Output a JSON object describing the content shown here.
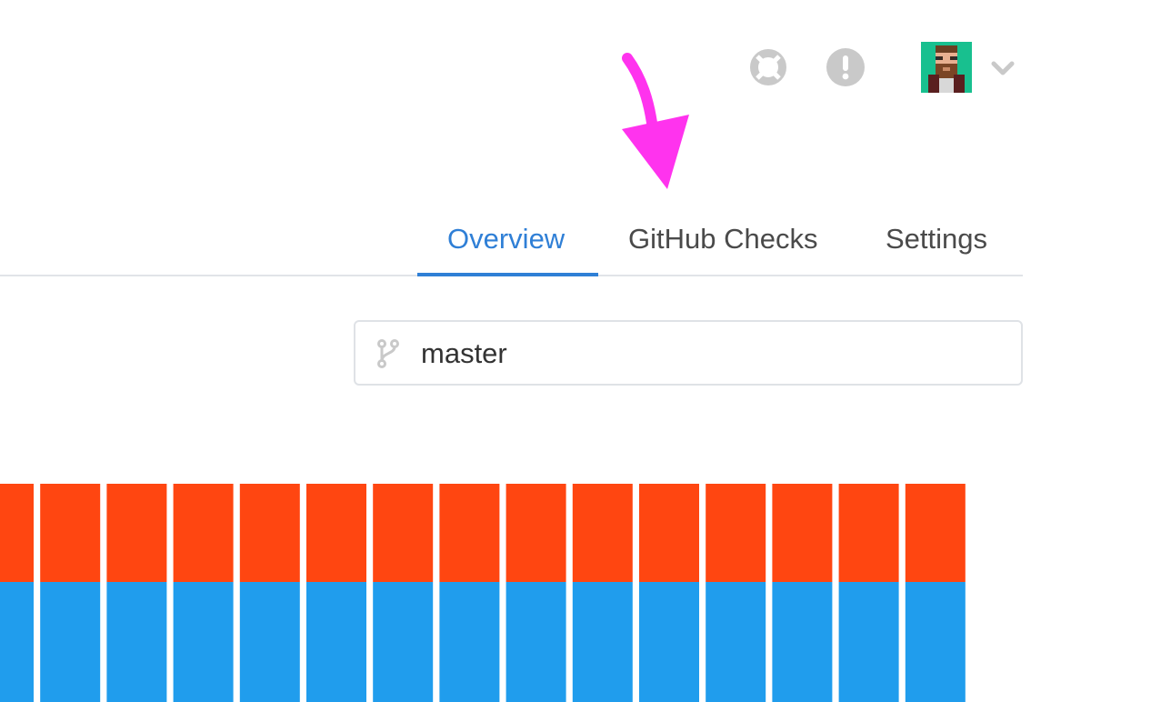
{
  "header": {
    "help_icon": "lifebuoy-icon",
    "alert_icon": "exclamation-circle-icon",
    "avatar_icon": "pixel-avatar",
    "menu_icon": "chevron-down-icon"
  },
  "annotation": {
    "arrow_icon": "arrow-down-icon",
    "arrow_color": "#ff33ee"
  },
  "tabs": {
    "items": [
      {
        "label": "Overview",
        "active": true
      },
      {
        "label": "GitHub Checks",
        "active": false
      },
      {
        "label": "Settings",
        "active": false
      }
    ],
    "active_color": "#2f7fd6"
  },
  "branch_selector": {
    "icon": "git-branch-icon",
    "value": "master"
  },
  "chart_data": {
    "type": "bar",
    "stacked": true,
    "categories": [
      "",
      "",
      "",
      "",
      "",
      "",
      "",
      "",
      "",
      "",
      "",
      "",
      "",
      "",
      ""
    ],
    "series": [
      {
        "color": "#209ded",
        "values": [
          0.55,
          0.55,
          0.55,
          0.55,
          0.55,
          0.55,
          0.55,
          0.55,
          0.55,
          0.55,
          0.55,
          0.55,
          0.55,
          0.55,
          0.55
        ]
      },
      {
        "color": "#ff4611",
        "values": [
          0.45,
          0.45,
          0.45,
          0.45,
          0.45,
          0.45,
          0.45,
          0.45,
          0.45,
          0.45,
          0.45,
          0.45,
          0.45,
          0.45,
          0.45
        ]
      }
    ],
    "ylim": [
      0,
      1
    ],
    "grid": false
  }
}
